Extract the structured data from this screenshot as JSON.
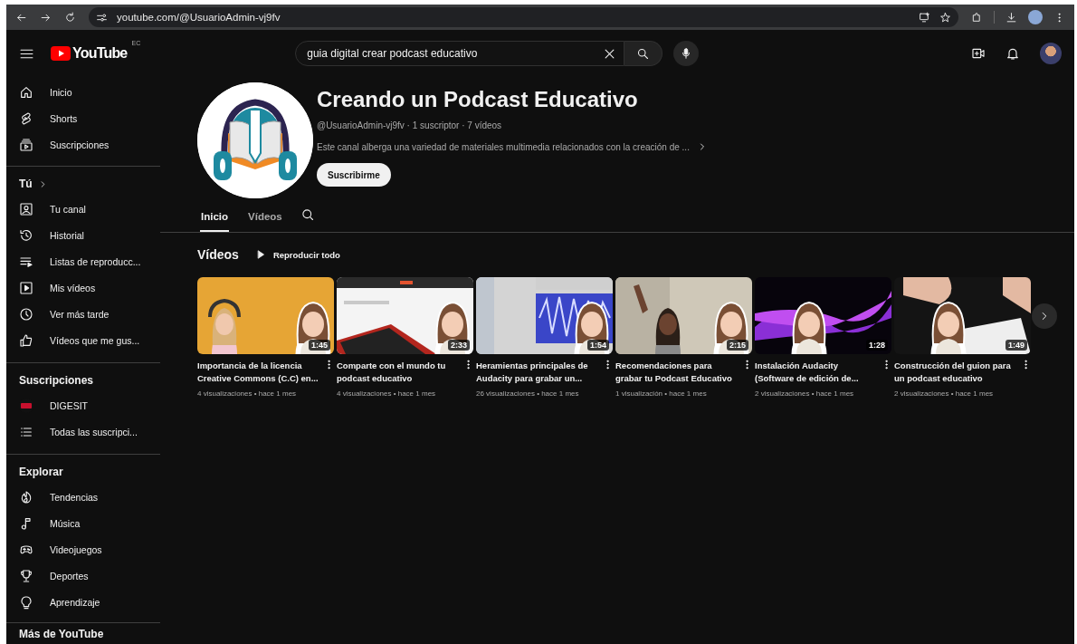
{
  "browser": {
    "url": "youtube.com/@UsuarioAdmin-vj9fv"
  },
  "masthead": {
    "logo_text": "YouTube",
    "region": "EC",
    "search": {
      "value": "guia digital crear podcast educativo"
    }
  },
  "sidebar": {
    "sections": [
      {
        "items": [
          {
            "label": "Inicio"
          },
          {
            "label": "Shorts"
          },
          {
            "label": "Suscripciones"
          }
        ]
      },
      {
        "heading": "Tú",
        "kind": "link",
        "items": [
          {
            "label": "Tu canal"
          },
          {
            "label": "Historial"
          },
          {
            "label": "Listas de reproducc..."
          },
          {
            "label": "Mis vídeos"
          },
          {
            "label": "Ver más tarde"
          },
          {
            "label": "Vídeos que me gus..."
          }
        ]
      },
      {
        "heading": "Suscripciones",
        "kind": "plain",
        "items": [
          {
            "label": "DIGESIT"
          },
          {
            "label": "Todas las suscripci..."
          }
        ]
      },
      {
        "heading": "Explorar",
        "kind": "plain",
        "items": [
          {
            "label": "Tendencias"
          },
          {
            "label": "Música"
          },
          {
            "label": "Videojuegos"
          },
          {
            "label": "Deportes"
          },
          {
            "label": "Aprendizaje"
          }
        ]
      },
      {
        "heading": "Más de YouTube",
        "kind": "plain"
      }
    ]
  },
  "channel": {
    "title": "Creando un Podcast Educativo",
    "meta": "@UsuarioAdmin-vj9fv · 1 suscriptor · 7 vídeos",
    "description": "Este canal alberga una variedad de materiales multimedia relacionados con la creación de ...",
    "subscribe_button": "Suscribirme"
  },
  "tabs": [
    {
      "label": "Inicio",
      "selected": true
    },
    {
      "label": "Vídeos",
      "selected": false
    }
  ],
  "videos_section": {
    "heading": "Vídeos",
    "play_all": "Reproducir todo"
  },
  "videos": [
    {
      "title": "Importancia de la licencia Creative Commons (C.C) en...",
      "duration": "1:45",
      "meta": "4 visualizaciones • hace 1 mes"
    },
    {
      "title": "Comparte con el mundo tu podcast educativo",
      "duration": "2:33",
      "meta": "4 visualizaciones • hace 1 mes"
    },
    {
      "title": "Heramientas principales de Audacity para grabar un...",
      "duration": "1:54",
      "meta": "26 visualizaciones • hace 1 mes"
    },
    {
      "title": "Recomendaciones para grabar tu Podcast Educativo",
      "duration": "2:15",
      "meta": "1 visualización • hace 1 mes"
    },
    {
      "title": "Instalación Audacity (Software de edición de...",
      "duration": "1:28",
      "meta": "2 visualizaciones • hace 1 mes"
    },
    {
      "title": "Construcción del guion para un podcast educativo",
      "duration": "1:49",
      "meta": "2 visualizaciones • hace 1 mes"
    }
  ]
}
